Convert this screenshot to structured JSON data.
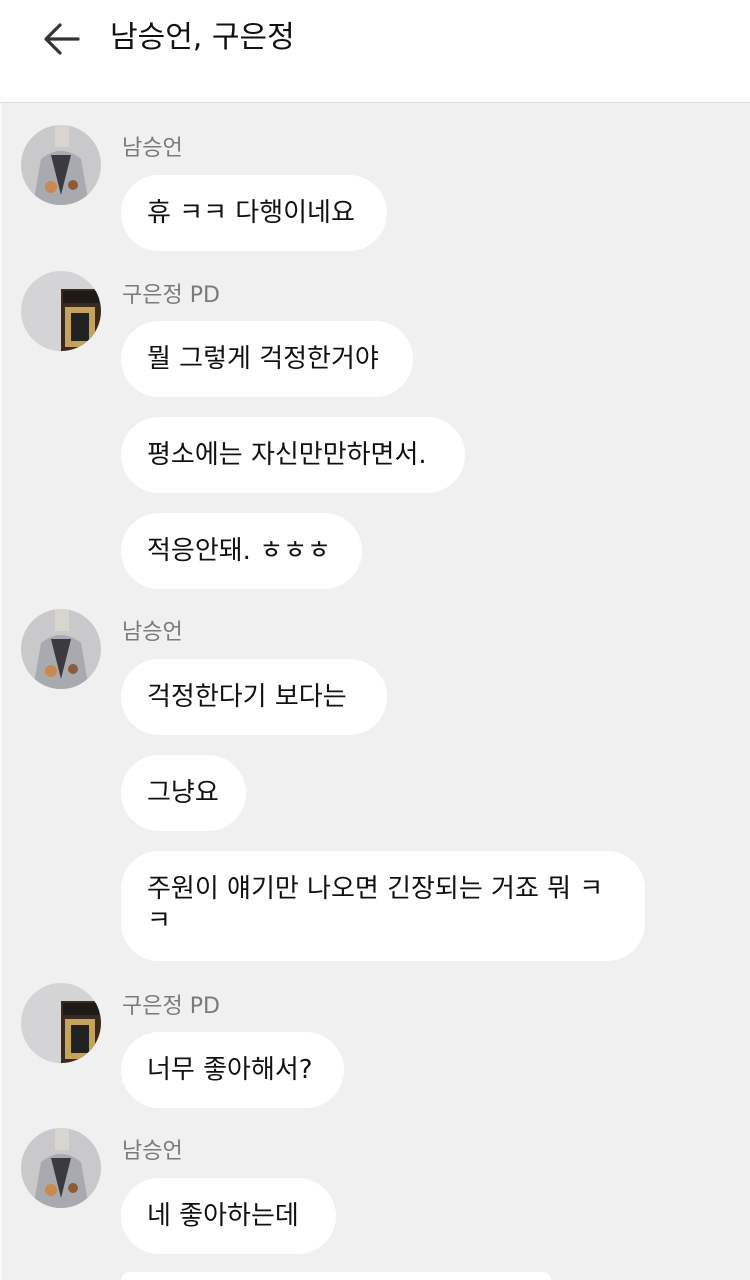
{
  "header": {
    "title": "남승언, 구은정",
    "back_icon": "arrow-left-icon"
  },
  "messages": [
    {
      "sender": "남승언",
      "bubbles": [
        "휴 ㅋㅋ 다행이네요"
      ]
    },
    {
      "sender": "구은정 PD",
      "bubbles": [
        "뭘 그렇게 걱정한거야",
        "평소에는 자신만만하면서.",
        "적응안돼. ㅎㅎㅎ"
      ]
    },
    {
      "sender": "남승언",
      "bubbles": [
        "걱정한다기 보다는",
        "그냥요",
        "주원이 얘기만 나오면 긴장되는 거죠 뭐 ㅋㅋ"
      ]
    },
    {
      "sender": "구은정 PD",
      "bubbles": [
        "너무 좋아해서?"
      ]
    },
    {
      "sender": "남승언",
      "bubbles": [
        "네 좋아하는데"
      ]
    }
  ],
  "colors": {
    "background": "#f0f0f0",
    "bubble": "#ffffff",
    "sender_text": "#7a7a7a"
  }
}
